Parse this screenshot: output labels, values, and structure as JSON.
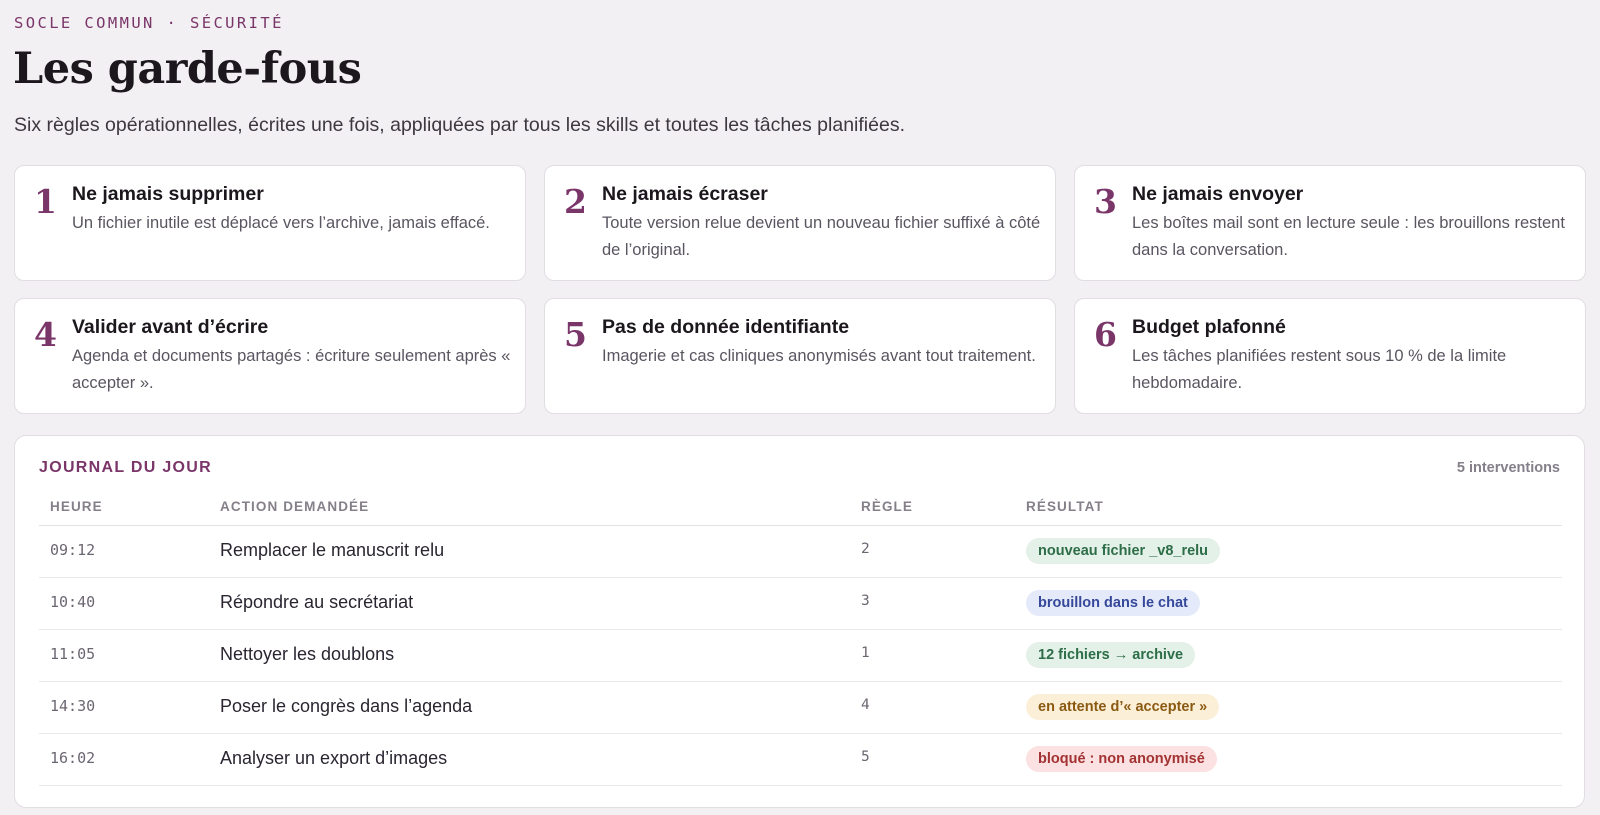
{
  "header": {
    "eyebrow": "SOCLE COMMUN · SÉCURITÉ",
    "title": "Les garde-fous",
    "subtitle": "Six règles opérationnelles, écrites une fois, appliquées par tous les skills et toutes les tâches planifiées."
  },
  "rules": [
    {
      "number": "1",
      "title": "Ne jamais supprimer",
      "description": "Un fichier inutile est déplacé vers l’archive, jamais effacé."
    },
    {
      "number": "2",
      "title": "Ne jamais écraser",
      "description": "Toute version relue devient un nouveau fichier suffixé à côté de l’original."
    },
    {
      "number": "3",
      "title": "Ne jamais envoyer",
      "description": "Les boîtes mail sont en lecture seule : les brouillons restent dans la conversation."
    },
    {
      "number": "4",
      "title": "Valider avant d’écrire",
      "description": "Agenda et documents partagés : écriture seulement après « accepter »."
    },
    {
      "number": "5",
      "title": "Pas de donnée identifiante",
      "description": "Imagerie et cas cliniques anonymisés avant tout traitement."
    },
    {
      "number": "6",
      "title": "Budget plafonné",
      "description": "Les tâches planifiées restent sous 10 % de la limite hebdomadaire."
    }
  ],
  "journal": {
    "title": "JOURNAL DU JOUR",
    "count": "5 interventions",
    "columns": {
      "heure": "HEURE",
      "action": "ACTION DEMANDÉE",
      "regle": "RÈGLE",
      "resultat": "RÉSULTAT"
    },
    "rows": [
      {
        "time": "09:12",
        "action": "Remplacer le manuscrit relu",
        "rule": "2",
        "result": "nouveau fichier _v8_relu",
        "status": "green"
      },
      {
        "time": "10:40",
        "action": "Répondre au secrétariat",
        "rule": "3",
        "result": "brouillon dans le chat",
        "status": "blue"
      },
      {
        "time": "11:05",
        "action": "Nettoyer les doublons",
        "rule": "1",
        "result": "12 fichiers → archive",
        "status": "green"
      },
      {
        "time": "14:30",
        "action": "Poser le congrès dans l’agenda",
        "rule": "4",
        "result": "en attente d’« accepter »",
        "status": "amber"
      },
      {
        "time": "16:02",
        "action": "Analyser un export d’images",
        "rule": "5",
        "result": "bloqué : non anonymisé",
        "status": "red"
      }
    ]
  }
}
